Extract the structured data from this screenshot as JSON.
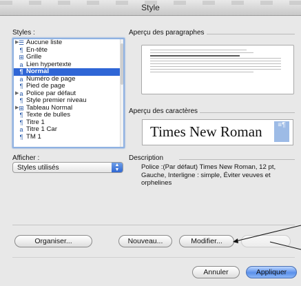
{
  "window": {
    "title": "Style"
  },
  "styles_label": "Styles :",
  "styles_list": [
    {
      "label": "Aucune liste",
      "icon": "list-icon",
      "glyph": "☰",
      "expand": true
    },
    {
      "label": "En-tête",
      "icon": "paragraph-icon",
      "glyph": "¶",
      "expand": false
    },
    {
      "label": "Grille",
      "icon": "table-icon",
      "glyph": "⊞",
      "expand": false
    },
    {
      "label": "Lien hypertexte",
      "icon": "character-style-icon",
      "glyph": "a",
      "expand": false
    },
    {
      "label": "Normal",
      "icon": "paragraph-icon",
      "glyph": "¶",
      "expand": false,
      "selected": true
    },
    {
      "label": "Numéro de page",
      "icon": "character-style-icon",
      "glyph": "a",
      "expand": false
    },
    {
      "label": "Pied de page",
      "icon": "paragraph-icon",
      "glyph": "¶",
      "expand": false
    },
    {
      "label": "Police par défaut",
      "icon": "character-style-icon",
      "glyph": "a",
      "expand": true
    },
    {
      "label": "Style premier niveau",
      "icon": "paragraph-icon",
      "glyph": "¶",
      "expand": false
    },
    {
      "label": "Tableau Normal",
      "icon": "table-icon",
      "glyph": "⊞",
      "expand": true
    },
    {
      "label": "Texte de bulles",
      "icon": "paragraph-icon",
      "glyph": "¶",
      "expand": false
    },
    {
      "label": "Titre 1",
      "icon": "paragraph-icon",
      "glyph": "¶",
      "expand": false
    },
    {
      "label": "Titre 1 Car",
      "icon": "character-style-icon",
      "glyph": "a",
      "expand": false
    },
    {
      "label": "TM 1",
      "icon": "paragraph-icon",
      "glyph": "¶",
      "expand": false
    }
  ],
  "paragraph_preview_label": "Aperçu des paragraphes",
  "character_preview_label": "Aperçu des caractères",
  "character_preview_text": "Times New Roman",
  "afficher_label": "Afficher :",
  "afficher_value": "Styles utilisés",
  "description_label": "Description",
  "description_text": "Police :(Par défaut) Times New Roman, 12 pt, Gauche, Interligne :  simple, Éviter veuves et orphelines",
  "buttons": {
    "organiser": "Organiser...",
    "nouveau": "Nouveau...",
    "modifier": "Modifier...",
    "annuler": "Annuler",
    "appliquer": "Appliquer"
  },
  "colors": {
    "selection": "#2f66d6",
    "default_button": "#5a90ea"
  }
}
